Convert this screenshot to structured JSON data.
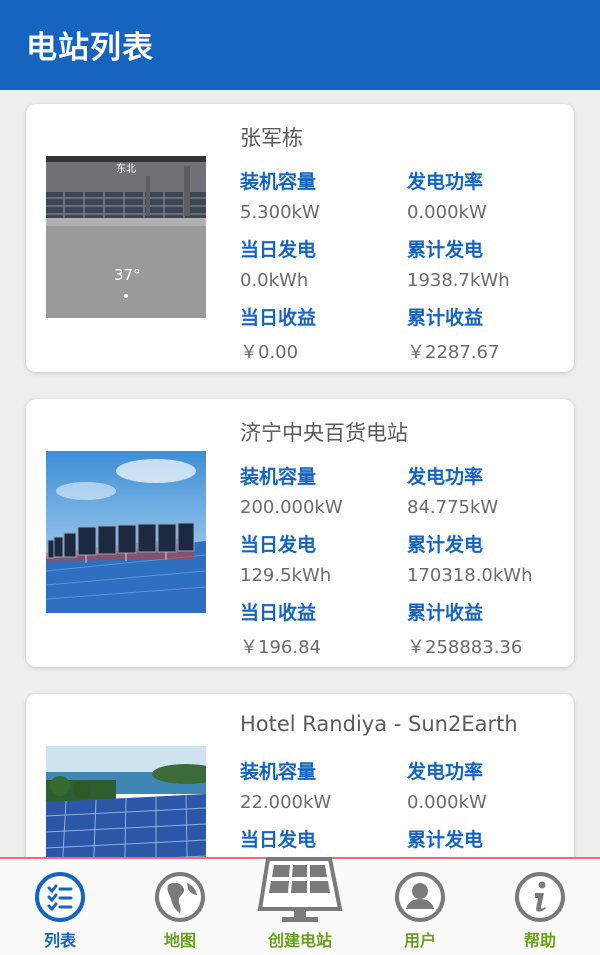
{
  "header": {
    "title": "电站列表"
  },
  "stations": [
    {
      "name": "张军栋",
      "capacity_label": "装机容量",
      "capacity": "5.300kW",
      "power_label": "发电功率",
      "power": "0.000kW",
      "day_gen_label": "当日发电",
      "day_gen": "0.0kWh",
      "total_gen_label": "累计发电",
      "total_gen": "1938.7kWh",
      "day_income_label": "当日收益",
      "day_income": "￥0.00",
      "total_income_label": "累计收益",
      "total_income": "￥2287.67",
      "photo": {
        "direction_text": "东北",
        "temp_text": "37°"
      }
    },
    {
      "name": "济宁中央百货电站",
      "capacity_label": "装机容量",
      "capacity": "200.000kW",
      "power_label": "发电功率",
      "power": "84.775kW",
      "day_gen_label": "当日发电",
      "day_gen": "129.5kWh",
      "total_gen_label": "累计发电",
      "total_gen": "170318.0kWh",
      "day_income_label": "当日收益",
      "day_income": "￥196.84",
      "total_income_label": "累计收益",
      "total_income": "￥258883.36"
    },
    {
      "name": "Hotel Randiya - Sun2Earth",
      "capacity_label": "装机容量",
      "capacity": "22.000kW",
      "power_label": "发电功率",
      "power": "0.000kW",
      "day_gen_label": "当日发电",
      "total_gen_label": "累计发电"
    }
  ],
  "tabs": [
    {
      "label": "列表",
      "icon": "list-icon",
      "active": true
    },
    {
      "label": "地图",
      "icon": "globe-icon",
      "active": false
    },
    {
      "label": "创建电站",
      "icon": "solar-panel-icon",
      "active": false
    },
    {
      "label": "用户",
      "icon": "user-icon",
      "active": false
    },
    {
      "label": "帮助",
      "icon": "info-icon",
      "active": false
    }
  ],
  "colors": {
    "primary": "#1565c0",
    "tab_label": "#6aa01e",
    "value_text": "#6b6b6b",
    "divider": "#e57373"
  }
}
